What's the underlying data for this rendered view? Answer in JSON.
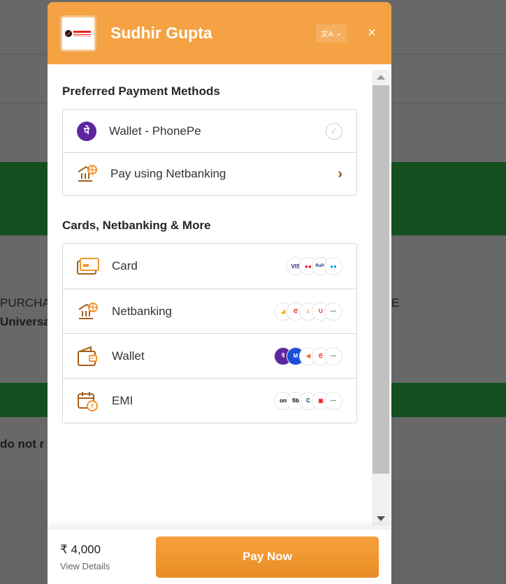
{
  "background": {
    "text1": "PURCHA",
    "text2": "Universa",
    "text3": "do not r",
    "text4": "E"
  },
  "header": {
    "title": "Sudhir Gupta",
    "logo_text": "GS CAREERS",
    "language_icon": "translate-icon",
    "close_label": "×",
    "accent": "#f4a243"
  },
  "preferred": {
    "heading": "Preferred Payment Methods",
    "items": [
      {
        "label": "Wallet - PhonePe",
        "icon": "phonepe-icon",
        "action": "check-circle-icon"
      },
      {
        "label": "Pay using Netbanking",
        "icon": "bank-icon",
        "action": "chevron-right-icon"
      }
    ]
  },
  "more": {
    "heading": "Cards, Netbanking & More",
    "items": [
      {
        "label": "Card",
        "icon": "card-icon",
        "logos": [
          "VISA",
          "Mastercard",
          "RuPay",
          "Maestro"
        ]
      },
      {
        "label": "Netbanking",
        "icon": "bank-icon",
        "logos": [
          "Axis",
          "Airtel",
          "Bank",
          "Union",
          "..."
        ]
      },
      {
        "label": "Wallet",
        "icon": "wallet-icon",
        "logos": [
          "PhonePe",
          "Mobikwik",
          "Freecharge",
          "Airtel Payments Bank",
          "..."
        ]
      },
      {
        "label": "EMI",
        "icon": "emi-icon",
        "logos": [
          "on",
          "fib",
          "Citi",
          "HDFC",
          "..."
        ]
      }
    ]
  },
  "footer": {
    "amount": "₹ 4,000",
    "details": "View Details",
    "pay_label": "Pay Now"
  }
}
